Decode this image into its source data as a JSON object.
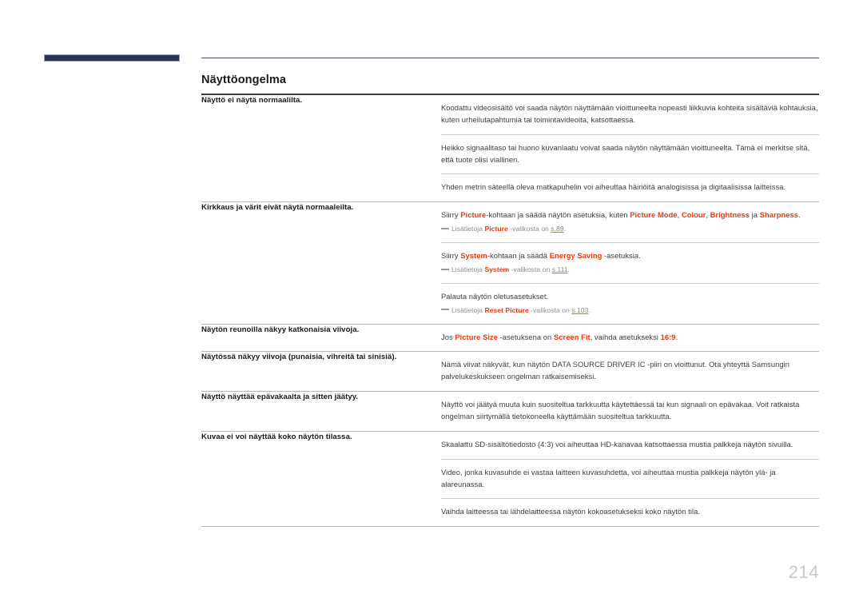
{
  "document": {
    "section_title": "Näyttöongelma",
    "page_number": "214",
    "accent_color": "#e8380d",
    "deco_color": "#2b3351",
    "link_color": "#8a8a72"
  },
  "rows": [
    {
      "question": "Näyttö ei näytä normaalilta.",
      "blocks": [
        {
          "paragraph_parts": [
            {
              "t": "Koodattu videosisältö voi saada näytön näyttämään vioittuneelta nopeasti liikkuvia kohteita sisältäviä kohtauksia, kuten urheilutapahtumia tai toimintavideoita, katsottaessa.",
              "k": false
            }
          ],
          "note_parts": []
        },
        {
          "paragraph_parts": [
            {
              "t": "Heikko signaalitaso tai huono kuvanlaatu voivat saada näytön näyttämään vioittuneelta. Tämä ei merkitse sitä, että tuote olisi viallinen.",
              "k": false
            }
          ],
          "note_parts": []
        },
        {
          "paragraph_parts": [
            {
              "t": "Yhden metrin säteellä oleva matkapuhelin voi aiheuttaa häiriöitä analogisissa ja digitaalisissa laitteissa.",
              "k": false
            }
          ],
          "note_parts": []
        }
      ]
    },
    {
      "question": "Kirkkaus ja värit eivät näytä normaaleilta.",
      "blocks": [
        {
          "paragraph_parts": [
            {
              "t": "Siirry ",
              "k": false
            },
            {
              "t": "Picture",
              "k": true
            },
            {
              "t": "-kohtaan ja säädä näytön asetuksia, kuten ",
              "k": false
            },
            {
              "t": "Picture Mode",
              "k": true
            },
            {
              "t": ", ",
              "k": false
            },
            {
              "t": "Colour",
              "k": true
            },
            {
              "t": ", ",
              "k": false
            },
            {
              "t": "Brightness",
              "k": true
            },
            {
              "t": " ja ",
              "k": false
            },
            {
              "t": "Sharpness",
              "k": true
            },
            {
              "t": ".",
              "k": false
            }
          ],
          "note_parts": [
            {
              "t": "Lisätietoja ",
              "k": false
            },
            {
              "t": "Picture",
              "k": true
            },
            {
              "t": " -valikosta on ",
              "k": false
            },
            {
              "t": "s.89",
              "k": false,
              "link": true
            },
            {
              "t": ".",
              "k": false
            }
          ]
        },
        {
          "paragraph_parts": [
            {
              "t": "Siirry ",
              "k": false
            },
            {
              "t": "System",
              "k": true
            },
            {
              "t": "-kohtaan ja säädä ",
              "k": false
            },
            {
              "t": "Energy Saving",
              "k": true
            },
            {
              "t": " -asetuksia.",
              "k": false
            }
          ],
          "note_parts": [
            {
              "t": "Lisätietoja ",
              "k": false
            },
            {
              "t": "System",
              "k": true
            },
            {
              "t": " -valikosta on ",
              "k": false
            },
            {
              "t": "s.111",
              "k": false,
              "link": true
            },
            {
              "t": ".",
              "k": false
            }
          ]
        },
        {
          "paragraph_parts": [
            {
              "t": "Palauta näytön oletusasetukset.",
              "k": false
            }
          ],
          "note_parts": [
            {
              "t": "Lisätietoja ",
              "k": false
            },
            {
              "t": "Reset Picture",
              "k": true
            },
            {
              "t": " -valikosta on ",
              "k": false
            },
            {
              "t": "s.103",
              "k": false,
              "link": true
            },
            {
              "t": ".",
              "k": false
            }
          ]
        }
      ]
    },
    {
      "question": "Näytön reunoilla näkyy katkonaisia viivoja.",
      "blocks": [
        {
          "paragraph_parts": [
            {
              "t": "Jos ",
              "k": false
            },
            {
              "t": "Picture Size",
              "k": true
            },
            {
              "t": " -asetuksena on ",
              "k": false
            },
            {
              "t": "Screen Fit",
              "k": true
            },
            {
              "t": ", vaihda asetukseksi ",
              "k": false
            },
            {
              "t": "16:9",
              "k": true
            },
            {
              "t": ".",
              "k": false
            }
          ],
          "note_parts": []
        }
      ]
    },
    {
      "question": "Näytössä näkyy viivoja (punaisia, vihreitä tai sinisiä).",
      "blocks": [
        {
          "paragraph_parts": [
            {
              "t": "Nämä viivat näkyvät, kun näytön DATA SOURCE DRIVER IC -piiri on vioittunut. Ota yhteyttä Samsungin palvelukeskukseen ongelman ratkaisemiseksi.",
              "k": false
            }
          ],
          "note_parts": []
        }
      ]
    },
    {
      "question": "Näyttö näyttää epävakaalta ja sitten jäätyy.",
      "blocks": [
        {
          "paragraph_parts": [
            {
              "t": "Näyttö voi jäätyä muuta kuin suositeltua tarkkuutta käytettäessä tai kun signaali on epävakaa. Voit ratkaista ongelman siirtymällä tietokoneella käyttämään suositeltua tarkkuutta.",
              "k": false
            }
          ],
          "note_parts": []
        }
      ]
    },
    {
      "question": "Kuvaa ei voi näyttää koko näytön tilassa.",
      "blocks": [
        {
          "paragraph_parts": [
            {
              "t": "Skaalattu SD-sisältötiedosto (4:3) voi aiheuttaa HD-kanavaa katsottaessa mustia palkkeja näytön sivuilla.",
              "k": false
            }
          ],
          "note_parts": []
        },
        {
          "paragraph_parts": [
            {
              "t": "Video, jonka kuvasuhde ei vastaa laitteen kuvasuhdetta, voi aiheuttaa mustia palkkeja näytön ylä- ja alareunassa.",
              "k": false
            }
          ],
          "note_parts": []
        },
        {
          "paragraph_parts": [
            {
              "t": "Vaihda laitteessa tai lähdelaitteessa näytön kokoasetukseksi koko näytön tila.",
              "k": false
            }
          ],
          "note_parts": []
        }
      ]
    }
  ]
}
